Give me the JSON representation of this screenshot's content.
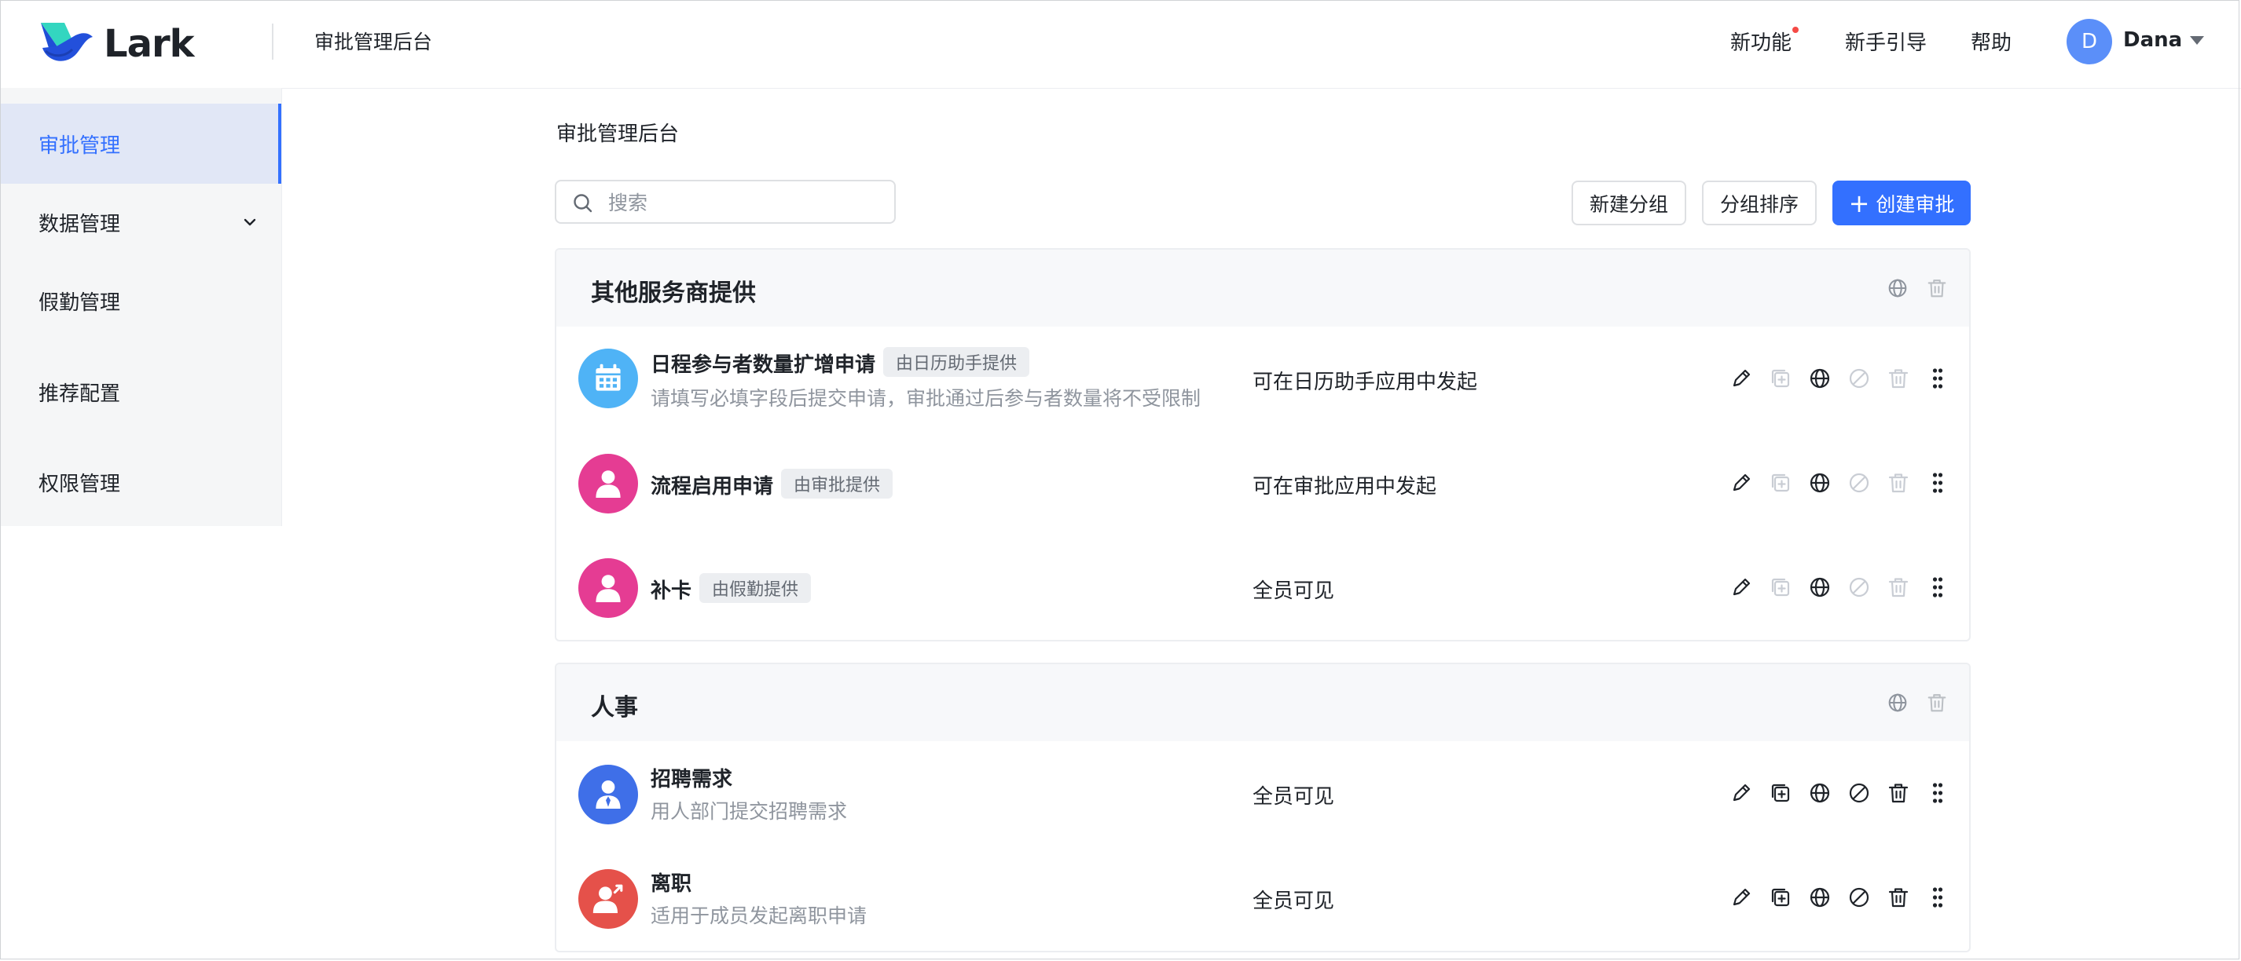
{
  "app": {
    "logo_text": "Lark",
    "title": "审批管理后台"
  },
  "header_nav": [
    {
      "label": "新功能",
      "has_dot": true
    },
    {
      "label": "新手引导"
    },
    {
      "label": "帮助"
    }
  ],
  "user": {
    "initial": "D",
    "name": "Dana"
  },
  "sidebar": {
    "items": [
      {
        "label": "审批管理",
        "active": true
      },
      {
        "label": "数据管理",
        "expandable": true
      },
      {
        "label": "假勤管理"
      },
      {
        "label": "推荐配置"
      },
      {
        "label": "权限管理"
      }
    ]
  },
  "page": {
    "title": "审批管理后台"
  },
  "search": {
    "placeholder": "搜索",
    "value": ""
  },
  "toolbar": {
    "new_group": "新建分组",
    "sort_groups": "分组排序",
    "create_approval": "创建审批"
  },
  "colors": {
    "accent": "#3370ff",
    "avatar_calendar": "#4fb3f6",
    "avatar_pink": "#e53c93",
    "avatar_blue": "#3f6fe8",
    "avatar_red": "#e5514a"
  },
  "groups": [
    {
      "title": "其他服务商提供",
      "rows": [
        {
          "name": "日程参与者数量扩增申请",
          "tag": "由日历助手提供",
          "desc": "请填写必填字段后提交申请，审批通过后参与者数量将不受限制",
          "scope": "可在日历助手应用中发起",
          "icon": "calendar-icon"
        },
        {
          "name": "流程启用申请",
          "tag": "由审批提供",
          "desc": "",
          "scope": "可在审批应用中发起",
          "icon": "person-icon"
        },
        {
          "name": "补卡",
          "tag": "由假勤提供",
          "desc": "",
          "scope": "全员可见",
          "icon": "person-icon"
        }
      ]
    },
    {
      "title": "人事",
      "rows": [
        {
          "name": "招聘需求",
          "tag": "",
          "desc": "用人部门提交招聘需求",
          "scope": "全员可见",
          "icon": "person-tie-icon"
        },
        {
          "name": "离职",
          "tag": "",
          "desc": "适用于成员发起离职申请",
          "scope": "全员可见",
          "icon": "person-leave-icon"
        }
      ]
    }
  ]
}
